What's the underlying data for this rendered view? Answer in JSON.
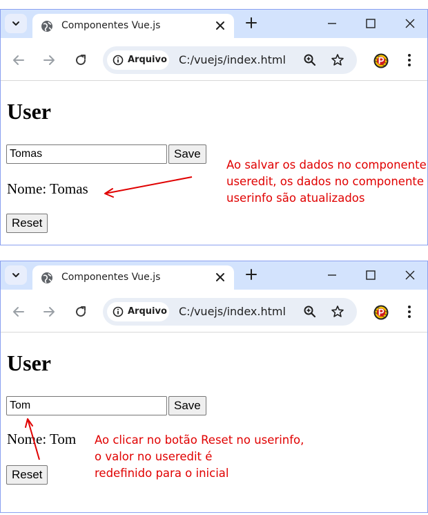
{
  "windows": [
    {
      "tab_title": "Componentes Vue.js",
      "security_chip": "Arquivo",
      "url": "C:/vuejs/index.html",
      "page": {
        "heading": "User",
        "input_value": "Tomas",
        "save_label": "Save",
        "nome_text": "Nome: Tomas",
        "reset_label": "Reset"
      },
      "annotation": {
        "lines": [
          "Ao salvar os dados no componente",
          "useredit, os dados no componente",
          "userinfo são atualizados"
        ]
      }
    },
    {
      "tab_title": "Componentes Vue.js",
      "security_chip": "Arquivo",
      "url": "C:/vuejs/index.html",
      "page": {
        "heading": "User",
        "input_value": "Tom",
        "save_label": "Save",
        "nome_text": "Nome: Tom",
        "reset_label": "Reset"
      },
      "annotation": {
        "lines": [
          "Ao clicar no botão Reset no userinfo,",
          "o valor no useredit é",
          "redefinido para o inicial"
        ]
      }
    }
  ],
  "colors": {
    "tabbar": "#d3e3fd",
    "omnibox": "#e9eef6",
    "annotation": "#e00000",
    "window_border": "#8aa0f0"
  },
  "icons": {
    "tab_search": "chevron-down-icon",
    "favicon": "globe-icon",
    "new_tab": "plus-icon",
    "back": "arrow-left-icon",
    "forward": "arrow-right-icon",
    "reload": "reload-icon",
    "info": "info-icon",
    "zoom": "zoom-in-icon",
    "bookmark": "star-icon",
    "profile": "profile-avatar-icon",
    "menu": "kebab-menu-icon"
  }
}
